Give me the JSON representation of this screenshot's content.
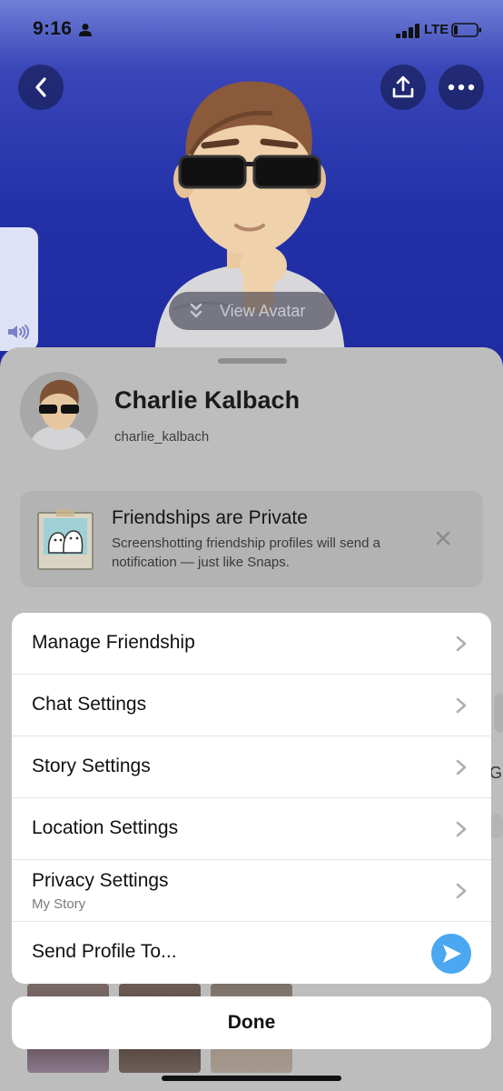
{
  "status_bar": {
    "time": "9:16",
    "network": "LTE"
  },
  "hero": {
    "view_avatar_label": "View Avatar",
    "icons": [
      "back-icon",
      "share-icon",
      "more-icon",
      "sound-icon"
    ]
  },
  "profile": {
    "name": "Charlie Kalbach",
    "username": "charlie_kalbach"
  },
  "privacy_notice": {
    "title": "Friendships are Private",
    "body": "Screenshotting friendship profiles will send a notification — just like Snaps."
  },
  "side_hint": {
    "text": "G"
  },
  "menu": {
    "items": [
      {
        "label": "Manage Friendship"
      },
      {
        "label": "Chat Settings"
      },
      {
        "label": "Story Settings"
      },
      {
        "label": "Location Settings"
      },
      {
        "label": "Privacy Settings",
        "sublabel": "My Story"
      },
      {
        "label": "Send Profile To..."
      }
    ]
  },
  "done_label": "Done",
  "colors": {
    "hero_blue": "#2331a8",
    "send_blue": "#4aa7f0",
    "sheet_dim": "#bdbdbd"
  }
}
